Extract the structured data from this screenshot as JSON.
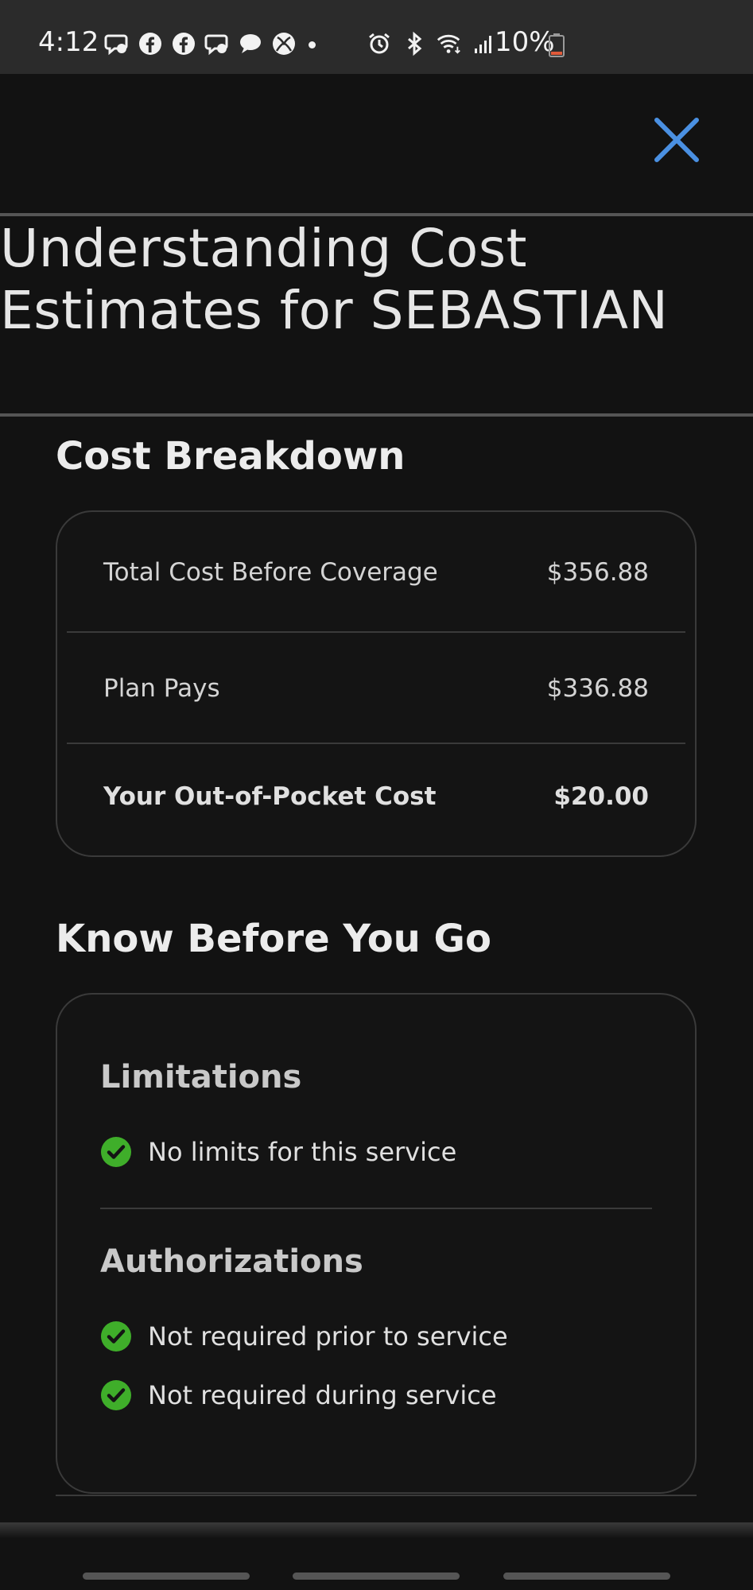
{
  "status_bar": {
    "time": "4:12",
    "battery": "10%",
    "notification_icons": [
      "chat-bubble-icon",
      "facebook-icon",
      "facebook-icon",
      "chat-bubble-icon",
      "message-icon",
      "xbox-icon"
    ],
    "system_icons": [
      "alarm-icon",
      "bluetooth-icon",
      "wifi-icon",
      "signal-icon"
    ]
  },
  "header": {
    "close_icon": "close-icon",
    "close_color": "#4a90e2",
    "title": "Understanding Cost Estimates for SEBASTIAN"
  },
  "cost_breakdown": {
    "heading": "Cost Breakdown",
    "rows": [
      {
        "label": "Total Cost Before Coverage",
        "value": "$356.88"
      },
      {
        "label": "Plan Pays",
        "value": "$336.88"
      },
      {
        "label": "Your Out-of-Pocket Cost",
        "value": "$20.00"
      }
    ]
  },
  "know_before": {
    "heading": "Know Before You Go",
    "limitations": {
      "heading": "Limitations",
      "items": [
        "No limits for this service"
      ]
    },
    "authorizations": {
      "heading": "Authorizations",
      "items": [
        "Not required prior to service",
        "Not required during service"
      ]
    }
  },
  "colors": {
    "background": "#121212",
    "check_green": "#3fae2a",
    "accent_blue": "#4a90e2"
  }
}
